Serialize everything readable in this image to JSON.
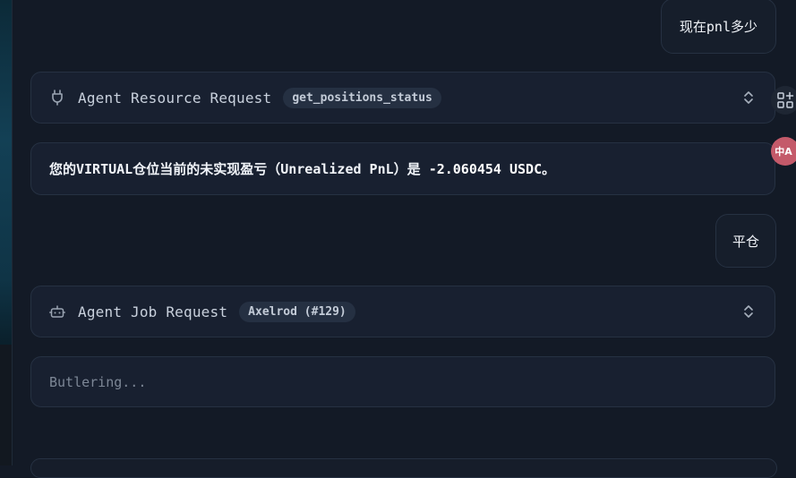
{
  "messages": {
    "user_1": "现在pnl多少",
    "resource_request": {
      "title": "Agent Resource Request",
      "tag": "get_positions_status"
    },
    "reply": {
      "prefix": "您的VIRTUAL仓位当前的未实现盈亏（Unrealized PnL）是 ",
      "value": "-2.060454 USDC",
      "suffix": "。"
    },
    "user_2": "平仓",
    "job_request": {
      "title": "Agent Job Request",
      "tag": "Axelrod (#129)"
    },
    "status": "Butlering..."
  },
  "side_tools": {
    "translate_label": "中A"
  },
  "icons": {
    "resource_icon": "plug-icon",
    "job_icon": "robot-icon",
    "expand_icon": "chevron-updown-icon",
    "apps_icon": "grid-apps-icon",
    "translate_icon": "translate-icon"
  },
  "colors": {
    "background": "#131a26",
    "card": "#182030",
    "border": "#263142",
    "pill": "#253042",
    "muted": "#7d8796",
    "translate_badge": "#c45a6a"
  }
}
